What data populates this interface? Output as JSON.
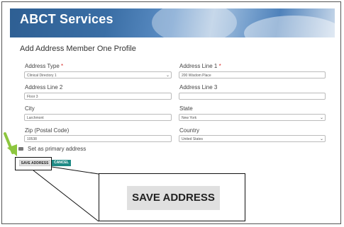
{
  "app": {
    "title": "ABCT Services"
  },
  "page": {
    "title": "Add Address Member One  Profile"
  },
  "form": {
    "address_type": {
      "label": "Address Type",
      "required_mark": "*",
      "value": "Clinical Directory 1"
    },
    "address_line_1": {
      "label": "Address Line 1",
      "required_mark": "*",
      "value": "200 Wisdom Place"
    },
    "address_line_2": {
      "label": "Address Line 2",
      "value": "Floor 3"
    },
    "address_line_3": {
      "label": "Address Line 3",
      "value": ""
    },
    "city": {
      "label": "City",
      "value": "Larchmont"
    },
    "state": {
      "label": "State",
      "value": "New York"
    },
    "zip": {
      "label": "Zip (Postal Code)",
      "value": "10538"
    },
    "country": {
      "label": "Country",
      "value": "United States"
    },
    "primary_checkbox": {
      "label": "Set as primary address",
      "checked": false
    }
  },
  "actions": {
    "save_label": "SAVE ADDRESS",
    "cancel_label": "CANCEL"
  },
  "callout": {
    "label": "SAVE ADDRESS"
  },
  "colors": {
    "banner": "#3a6ea5",
    "cancel_button": "#1f8a85",
    "annotation_arrow": "#8dc63f",
    "required": "#d9302c"
  },
  "icons": {
    "select_chevron": "chevron-down-icon",
    "annotation": "arrow-pointer-icon"
  }
}
